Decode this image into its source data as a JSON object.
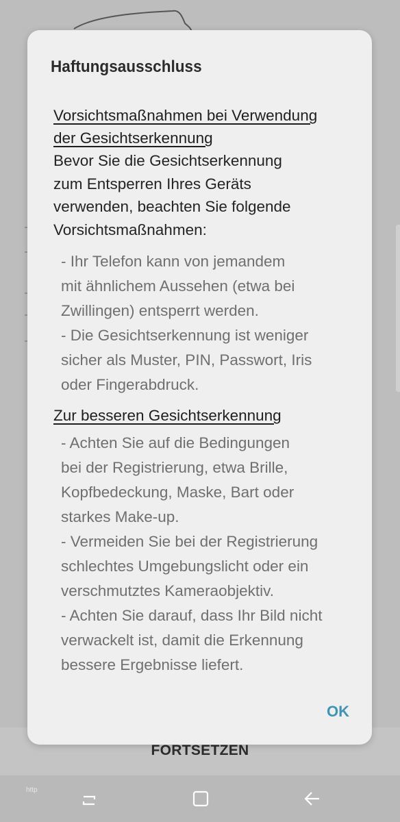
{
  "dialog": {
    "title": "Haftungsausschluss",
    "section1": {
      "heading_line1": "Vorsichtsmaßnahmen bei Verwendung",
      "heading_line2": "der Gesichtserkennung",
      "intro_lines": [
        "Bevor Sie die Gesichtserkennung",
        "zum Entsperren Ihres Geräts",
        "verwenden, beachten Sie folgende",
        "Vorsichtsmaßnahmen:"
      ],
      "bullet_lines": [
        "- Ihr Telefon kann von jemandem",
        "mit ähnlichem Aussehen (etwa bei",
        "Zwillingen) entsperrt werden.",
        "- Die Gesichtserkennung ist weniger",
        "sicher als Muster, PIN, Passwort, Iris",
        "oder Fingerabdruck."
      ]
    },
    "section2": {
      "heading": "Zur besseren Gesichtserkennung",
      "bullet_lines": [
        "- Achten Sie auf die Bedingungen",
        "bei der Registrierung, etwa Brille,",
        "Kopfbedeckung, Maske, Bart oder",
        "starkes Make-up.",
        "- Vermeiden Sie bei der Registrierung",
        "schlechtes Umgebungslicht oder ein",
        "verschmutztes Kameraobjektiv.",
        "- Achten Sie darauf, dass Ihr Bild nicht",
        "verwackelt ist, damit die Erkennung",
        "bessere Ergebnisse liefert."
      ]
    },
    "ok_label": "OK",
    "accent_color": "#3f93b3"
  },
  "background": {
    "continue_label": "FORTSETZEN",
    "nav_small_text": "http"
  },
  "navbar": {
    "icons": [
      "recent-apps-icon",
      "home-icon",
      "back-icon"
    ]
  }
}
